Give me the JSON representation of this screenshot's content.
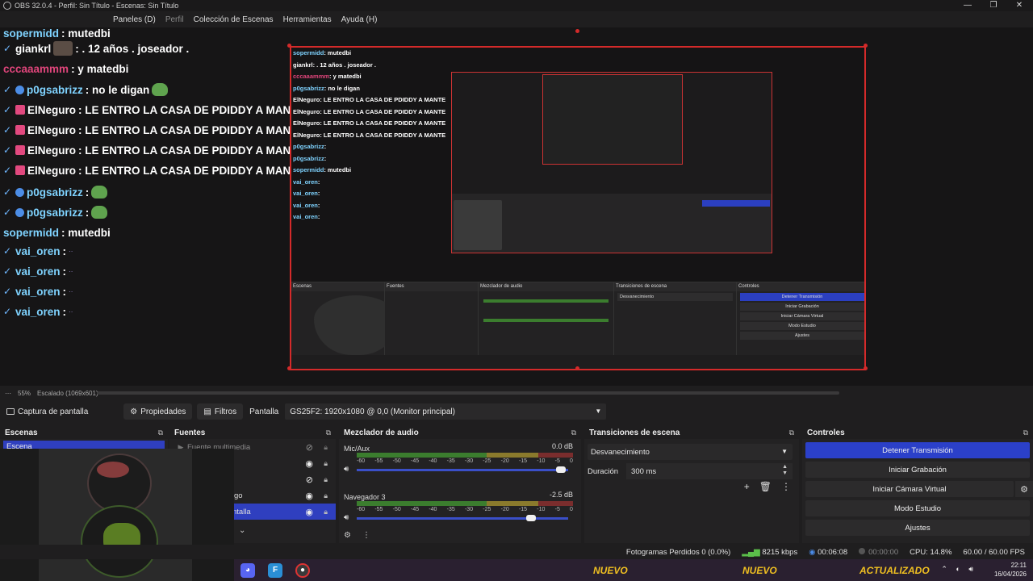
{
  "window": {
    "title": "OBS 32.0.4 - Perfil: Sin Título - Escenas: Sin Título",
    "controls": [
      "—",
      "❐",
      "✕"
    ]
  },
  "menu": [
    "Paneles (D)",
    "Perfil",
    "Colección de Escenas",
    "Herramientas",
    "Ayuda (H)"
  ],
  "chat": [
    {
      "user": "sopermidd",
      "text": ": mutedbi",
      "color": "#7fd3ff"
    },
    {
      "user": "giankrl",
      "text": ": . 12 años . joseador .",
      "color": "#ffffff"
    },
    {
      "user": "cccaaammm",
      "text": ": y matedbi",
      "color": "#e0457b"
    },
    {
      "user": "p0gsabrizz",
      "text": ": no le digan",
      "color": "#7fd3ff"
    },
    {
      "user": "ElNeguro",
      "text": ": LE ENTRO LA CASA DE PDIDDY A MANTE",
      "color": "#ffffff"
    },
    {
      "user": "ElNeguro",
      "text": ": LE ENTRO LA CASA DE PDIDDY A MANTE",
      "color": "#ffffff"
    },
    {
      "user": "ElNeguro",
      "text": ": LE ENTRO LA CASA DE PDIDDY A MANTE",
      "color": "#ffffff"
    },
    {
      "user": "ElNeguro",
      "text": ": LE ENTRO LA CASA DE PDIDDY A MANTE",
      "color": "#ffffff"
    },
    {
      "user": "p0gsabrizz",
      "text": ":",
      "color": "#7fd3ff"
    },
    {
      "user": "p0gsabrizz",
      "text": ":",
      "color": "#7fd3ff"
    },
    {
      "user": "sopermidd",
      "text": ": mutedbi",
      "color": "#7fd3ff"
    },
    {
      "user": "vai_oren",
      "text": ":",
      "color": "#7fd3ff"
    },
    {
      "user": "vai_oren",
      "text": ":",
      "color": "#7fd3ff"
    },
    {
      "user": "vai_oren",
      "text": ":",
      "color": "#7fd3ff"
    },
    {
      "user": "vai_oren",
      "text": ":",
      "color": "#7fd3ff"
    }
  ],
  "preview_footer": {
    "zoom": "55%",
    "scaled": "Escalado (1069x601)"
  },
  "source_bar": {
    "source_name": "Captura de pantalla",
    "properties": "Propiedades",
    "filters": "Filtros",
    "screen_label": "Pantalla",
    "monitor": "GS25F2: 1920x1080 @ 0,0 (Monitor principal)"
  },
  "scenes": {
    "title": "Escenas",
    "items": [
      "Escena"
    ]
  },
  "sources": {
    "title": "Fuentes",
    "items": [
      "Fuente multimedia",
      "",
      "",
      "go",
      "ntalla"
    ]
  },
  "mixer": {
    "title": "Mezclador de audio",
    "scale": [
      "-60",
      "-55",
      "-50",
      "-45",
      "-40",
      "-35",
      "-30",
      "-25",
      "-20",
      "-15",
      "-10",
      "-5",
      "0"
    ],
    "channels": [
      {
        "name": "Mic/Aux",
        "db": "0.0 dB",
        "level": 0.98
      },
      {
        "name": "Navegador 3",
        "db": "-2.5 dB",
        "level": 0.84
      }
    ]
  },
  "transitions": {
    "title": "Transiciones de escena",
    "selected": "Desvanecimiento",
    "duration_label": "Duración",
    "duration_value": "300 ms"
  },
  "controls": {
    "title": "Controles",
    "buttons": [
      "Detener Transmisión",
      "Iniciar Grabación",
      "Iniciar Cámara Virtual",
      "Modo Estudio",
      "Ajustes"
    ]
  },
  "status": {
    "dropped": "Fotogramas Perdidos 0 (0.0%)",
    "bitrate": "8215 kbps",
    "stream_time": "00:06:08",
    "rec_time": "00:00:00",
    "cpu": "CPU: 14.8%",
    "fps": "60.00 / 60.00 FPS"
  },
  "taskbar": {
    "time": "22:11",
    "date": "16/04/2026",
    "banners": [
      "NUEVO",
      "NUEVO",
      "ACTUALIZADO"
    ]
  },
  "colors": {
    "accent": "#2b40c9",
    "selection_border": "#d42a2a",
    "meter_green": "#3b7d2e"
  }
}
